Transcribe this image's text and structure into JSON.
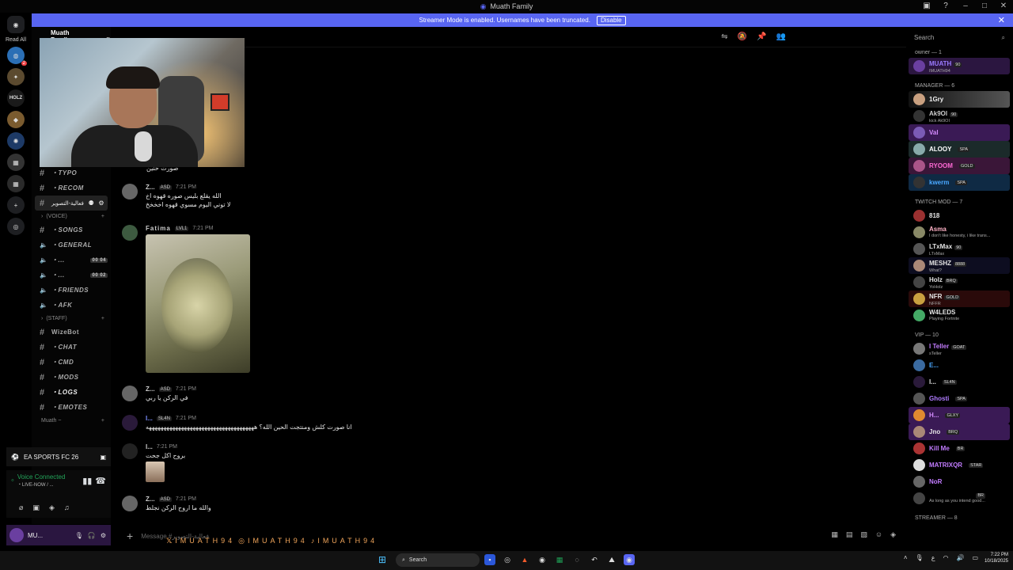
{
  "window": {
    "title": "Muath Family"
  },
  "banner": {
    "text": "Streamer Mode is enabled. Usernames have been truncated.",
    "button": "Disable"
  },
  "guilds": {
    "read_all": "Read All",
    "badge": "2"
  },
  "server": {
    "name": "Muath Family",
    "current_channel": "فعالية-التصوير"
  },
  "channels": [
    {
      "kind": "text",
      "label": "・TYPO",
      "icon": "hash-icon"
    },
    {
      "kind": "text-selected",
      "label": "فعالية-التصوير",
      "icon": "hash-icon"
    },
    {
      "kind": "cat",
      "label": "(VOICE)"
    },
    {
      "kind": "text",
      "label": "・SONGS",
      "icon": "hash-icon"
    },
    {
      "kind": "voice",
      "label": "・GENERAL"
    },
    {
      "kind": "voice-count",
      "label": "・...",
      "count": "00  04"
    },
    {
      "kind": "voice-count",
      "label": "・...",
      "count": "00  02"
    },
    {
      "kind": "voice",
      "label": "・FRIENDS"
    },
    {
      "kind": "voice",
      "label": "・AFK"
    },
    {
      "kind": "cat",
      "label": "(STAFF)"
    },
    {
      "kind": "text",
      "label": "WizeBot",
      "icon": "hash-icon"
    },
    {
      "kind": "text",
      "label": "・CHAT",
      "icon": "hash-icon"
    },
    {
      "kind": "text",
      "label": "・CMD",
      "icon": "hash-icon"
    },
    {
      "kind": "text",
      "label": "・MODS",
      "icon": "hash-icon"
    },
    {
      "kind": "text",
      "label": "・LOGS",
      "icon": "hash-icon"
    },
    {
      "kind": "text",
      "label": "・EMOTES",
      "icon": "hash-icon"
    }
  ],
  "channels_top": {
    "recom": "・RECOM"
  },
  "footer_cat": "Muath ~",
  "activity": {
    "game": "EA SPORTS FC 26"
  },
  "voice": {
    "status": "Voice Connected",
    "channel": "・LIVE-NOW / ..."
  },
  "user": {
    "name": "MU..."
  },
  "messages": [
    {
      "name": "",
      "tag": "",
      "time": "",
      "lines": [
        "صورت حنين"
      ]
    },
    {
      "name": "Z...",
      "tag": "ASD",
      "time": "7:21 PM",
      "lines": [
        "الله يقلع بليس صوره قهوه اخ",
        "لا توني اليوم مسوي قهوه اخخخخ"
      ]
    },
    {
      "name": "Fatima",
      "tag": "LVL1",
      "time": "7:21 PM",
      "lines": []
    },
    {
      "name": "Z...",
      "tag": "ASD",
      "time": "7:21 PM",
      "lines": [
        "في الركن يا ربي"
      ]
    },
    {
      "name": "I...",
      "tag": "SL4N",
      "time": "7:21 PM",
      "lines": [
        "انا صورت كلش ومنتجت الحين الله؟ هههههههههههههههههههههههههههههههههههههه"
      ]
    },
    {
      "name": "I...",
      "tag": "",
      "time": "7:21 PM",
      "lines": [
        "بروح اكل جحت"
      ]
    },
    {
      "name": "Z...",
      "tag": "ASD",
      "time": "7:21 PM",
      "lines": [
        "والله ما اروح الركن نجلط"
      ]
    }
  ],
  "composer": {
    "placeholder": "Message #فعالية-التصوير",
    "promo": [
      "IMUATH94",
      "IMUATH94",
      "IMUATH94"
    ]
  },
  "search": {
    "placeholder": "Search"
  },
  "members": {
    "groups": [
      {
        "title": "owner — 1",
        "members": [
          {
            "name": "MUATH",
            "tag": "90",
            "sub": "IMUATH94",
            "color": "#9b7bff",
            "bg": "#2b1640"
          }
        ]
      },
      {
        "title": "MANAGER — 6",
        "members": [
          {
            "name": "1Gry",
            "tag": "",
            "sub": "",
            "color": "#f0f0f0",
            "bg": "#3a3a3a"
          },
          {
            "name": "Ak9Ol",
            "tag": "90",
            "sub": "kick Ak9OI",
            "color": "#cfcfcf",
            "bg": ""
          },
          {
            "name": "Val",
            "tag": "",
            "sub": "",
            "color": "#d58cff",
            "bg": "#3a1a55"
          },
          {
            "name": "ALOOY",
            "tag": "SPA",
            "sub": "",
            "color": "#ffffff",
            "bg": "#233"
          },
          {
            "name": "RYOOM",
            "tag": "GOLD",
            "sub": "",
            "color": "#ff6ad5",
            "bg": "#3a1638"
          },
          {
            "name": "kwerm",
            "tag": "SPA",
            "sub": "",
            "color": "#4aa8ff",
            "bg": "#0f2a44"
          }
        ]
      },
      {
        "title": "TWITCH MOD — 7",
        "members": [
          {
            "name": "818",
            "tag": "",
            "sub": "",
            "color": "#e5e5e5",
            "bg": ""
          },
          {
            "name": "Asma",
            "tag": "",
            "sub": "I don't like honesty, i like trans...",
            "color": "#ffb3c7",
            "bg": ""
          },
          {
            "name": "LTxMax",
            "tag": "90",
            "sub": "LTxMax",
            "color": "#e5e5e5",
            "bg": ""
          },
          {
            "name": "MESHZ",
            "tag": "8888",
            "sub": "What?",
            "color": "#e5e5e5",
            "bg": "#0d0d20"
          },
          {
            "name": "Holz",
            "tag": "BRQ",
            "sub": "YoHolz",
            "color": "#e5e5e5",
            "bg": ""
          },
          {
            "name": "NFR",
            "tag": "GOLD",
            "sub": "NFFR",
            "color": "#e5e5e5",
            "bg": "#2a0a0a"
          },
          {
            "name": "W4LEDS",
            "tag": "",
            "sub": "Playing Fortnite",
            "color": "#e5e5e5",
            "bg": ""
          }
        ]
      },
      {
        "title": "VIP — 10",
        "members": [
          {
            "name": "I Teller",
            "tag": "GOAT",
            "sub": "sTeller",
            "color": "#c27cff",
            "bg": ""
          },
          {
            "name": "E...",
            "tag": "",
            "sub": "",
            "color": "#4aa8ff",
            "bg": ""
          },
          {
            "name": "I...",
            "tag": "SL4N",
            "sub": "",
            "color": "#e5e5e5",
            "bg": ""
          },
          {
            "name": "Ghosti",
            "tag": "SPA",
            "sub": "",
            "color": "#b07cff",
            "bg": ""
          },
          {
            "name": "H...",
            "tag": "GLXY",
            "sub": "",
            "color": "#d58cff",
            "bg": "#3a1a55"
          },
          {
            "name": "Jno",
            "tag": "BRQ",
            "sub": "",
            "color": "#e5e5e5",
            "bg": "#3a1a55"
          },
          {
            "name": "Kill Me",
            "tag": "BR",
            "sub": "",
            "color": "#c27cff",
            "bg": ""
          },
          {
            "name": "MATRIXQR",
            "tag": "STAR",
            "sub": "",
            "color": "#c27cff",
            "bg": ""
          },
          {
            "name": "NoR",
            "tag": "",
            "sub": "",
            "color": "#c27cff",
            "bg": ""
          },
          {
            "name": "",
            "tag": "BR",
            "sub": "As long as you intend good...",
            "color": "#e5e5e5",
            "bg": ""
          }
        ]
      },
      {
        "title": "STREAMER — 8",
        "members": []
      }
    ]
  },
  "taskbar": {
    "search": "Search",
    "time": "7:22 PM",
    "date": "10/18/2025"
  }
}
